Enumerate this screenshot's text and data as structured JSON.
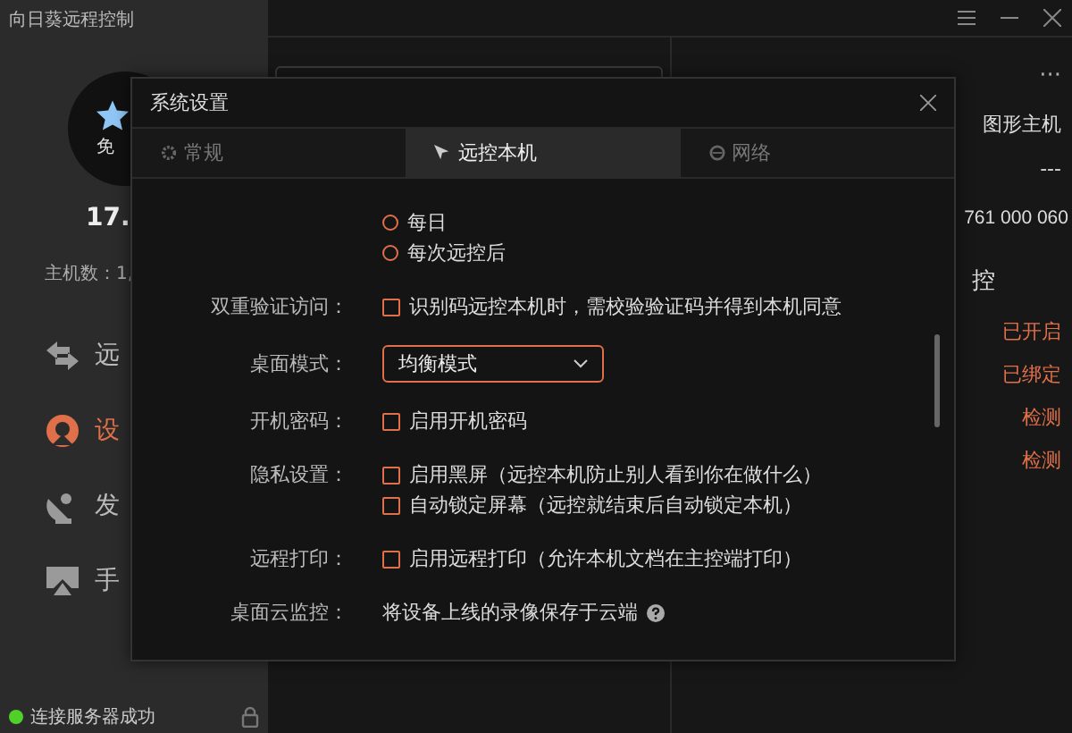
{
  "app": {
    "title": "向日葵远程控制"
  },
  "profile": {
    "badge": "免",
    "name": "17.",
    "host_count": "主机数：1,"
  },
  "nav": [
    {
      "label": "远",
      "selected": false
    },
    {
      "label": "设",
      "selected": true
    },
    {
      "label": "发",
      "selected": false
    },
    {
      "label": "手",
      "selected": false
    }
  ],
  "status": {
    "text": "连接服务器成功",
    "connected": true
  },
  "device": {
    "more": "···",
    "rows": [
      {
        "text": "图形主机",
        "kind": "label"
      },
      {
        "text": "---",
        "kind": "label"
      },
      {
        "text": "761 000 060",
        "kind": "large"
      },
      {
        "text": "控",
        "kind": "section"
      },
      {
        "text": "已开启",
        "kind": "status"
      },
      {
        "text": "已绑定",
        "kind": "status"
      },
      {
        "text": "检测",
        "kind": "status"
      },
      {
        "text": "检测",
        "kind": "status"
      }
    ]
  },
  "dialog": {
    "title": "系统设置",
    "tabs": [
      {
        "label": "常规",
        "selected": false
      },
      {
        "label": "远控本机",
        "selected": true
      },
      {
        "label": "网络",
        "selected": false
      }
    ],
    "settings": [
      {
        "kind": "radio",
        "options": [
          {
            "label": "每日",
            "selected": false
          },
          {
            "label": "每次远控后",
            "selected": false
          }
        ]
      },
      {
        "kind": "checkbox",
        "label": "双重验证访问：",
        "options": [
          {
            "label": "识别码远控本机时，需校验验证码并得到本机同意",
            "checked": false
          }
        ]
      },
      {
        "kind": "dropdown",
        "label": "桌面模式：",
        "value": "均衡模式"
      },
      {
        "kind": "checkbox",
        "label": "开机密码：",
        "options": [
          {
            "label": "启用开机密码",
            "checked": false
          }
        ]
      },
      {
        "kind": "checkbox",
        "label": "隐私设置：",
        "options": [
          {
            "label": "启用黑屏（远控本机防止别人看到你在做什么）",
            "checked": false
          },
          {
            "label": "自动锁定屏幕（远控就结束后自动锁定本机）",
            "checked": false
          }
        ]
      },
      {
        "kind": "checkbox",
        "label": "远程打印：",
        "options": [
          {
            "label": "启用远程打印（允许本机文档在主控端打印）",
            "checked": false
          }
        ]
      },
      {
        "kind": "info",
        "label": "桌面云监控：",
        "text": "将设备上线的录像保存于云端"
      }
    ]
  }
}
